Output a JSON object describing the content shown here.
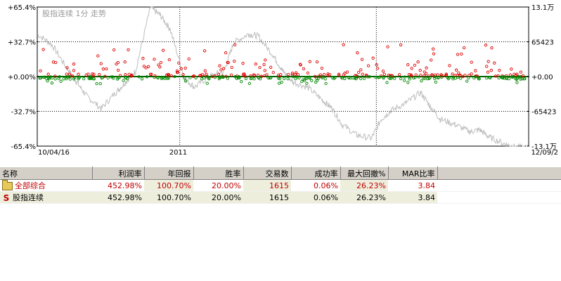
{
  "chart": {
    "title": "股指连续 1分 走势",
    "y_left_ticks": [
      "+65.4%",
      "+32.7%",
      "+0.00%",
      "-32.7%",
      "-65.4%"
    ],
    "y_right_ticks": [
      "13.1万",
      "65423",
      "+0.00",
      "-65423",
      "-13.1万"
    ],
    "x_ticks": [
      "10/04/16",
      "2011",
      "12/09/2"
    ],
    "colors": {
      "price_line": "#bdbdbd",
      "zero_line": "#006400",
      "profit_marker": "#dd0000",
      "loss_marker": "#008800",
      "grid": "#000000"
    }
  },
  "chart_data": {
    "type": "line",
    "title": "股指连续 1分 走势",
    "x_range": [
      "10/04/16",
      "12/09/2"
    ],
    "ylim_left": [
      -65.4,
      65.4
    ],
    "ylim_right": [
      -131000,
      131000
    ],
    "series": [
      {
        "name": "股指连续",
        "x_fraction": [
          0.0,
          0.03,
          0.06,
          0.08,
          0.1,
          0.13,
          0.16,
          0.18,
          0.2,
          0.23,
          0.25,
          0.27,
          0.3,
          0.32,
          0.35,
          0.38,
          0.4,
          0.43,
          0.45,
          0.48,
          0.5,
          0.52,
          0.55,
          0.58,
          0.6,
          0.62,
          0.65,
          0.68,
          0.7,
          0.72,
          0.75,
          0.78,
          0.8,
          0.82,
          0.85,
          0.88,
          0.9,
          0.92,
          0.95,
          0.97,
          1.0
        ],
        "values": [
          40,
          30,
          8,
          -5,
          -18,
          -30,
          -15,
          -5,
          5,
          65,
          58,
          45,
          -2,
          -10,
          0,
          5,
          32,
          40,
          38,
          20,
          5,
          -5,
          -10,
          -22,
          -30,
          -45,
          -55,
          -58,
          -40,
          -32,
          -25,
          -15,
          -28,
          -40,
          -45,
          -52,
          -50,
          -57,
          -63,
          -66,
          -67
        ]
      }
    ],
    "zero_line": 0
  },
  "table": {
    "headers": [
      "名称",
      "利润率",
      "年回报",
      "胜率",
      "交易数",
      "成功率",
      "最大回撤%",
      "MAR比率"
    ],
    "rows": [
      {
        "icon": "folder-icon",
        "cells": [
          "全部综合",
          "452.98%",
          "100.70%",
          "20.00%",
          "1615",
          "0.06%",
          "26.23%",
          "3.84"
        ]
      },
      {
        "icon": "s-icon",
        "icon_text": "S",
        "cells": [
          "股指连续",
          "452.98%",
          "100.70%",
          "20.00%",
          "1615",
          "0.06%",
          "26.23%",
          "3.84"
        ]
      }
    ]
  }
}
